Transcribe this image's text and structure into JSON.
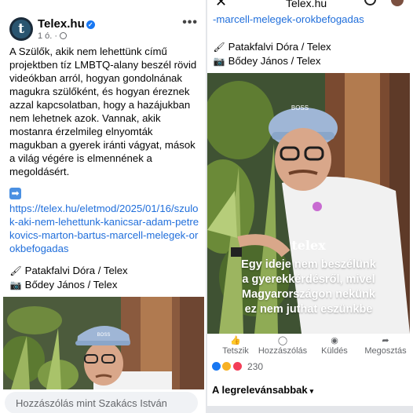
{
  "left": {
    "page_name": "Telex.hu",
    "avatar_letter": "t",
    "time": "1 ó.",
    "more": "•••",
    "paragraphs": [
      "A Szülők, akik nem lehettünk című projektben tíz LMBTQ-alany beszél rövid videókban arról, hogyan gondolnának magukra szülőként, és hogyan éreznek azzal kapcsolatban, hogy a hazájukban nem lehetnek azok. Vannak, akik mostanra érzelmileg elnyomták magukban a gyerek iránti vágyat, mások a világ végére is elmennének a megoldásért."
    ],
    "arrow": "➡",
    "link": "https://telex.hu/eletmod/2025/01/16/szulok-aki-nem-lehettunk-kanicsar-adam-petrekovics-marton-bartus-marcell-melegek-orokbefogadas",
    "credit1_emoji": "🖌",
    "credit1": "Patakfalvi Dóra / Telex",
    "credit2_emoji": "📷",
    "credit2": "Bődey János / Telex",
    "comment_placeholder": "Hozzászólás mint Szakács István"
  },
  "right": {
    "nav_title": "Telex.hu",
    "close": "✕",
    "link_tail": "-marcell-melegek-orokbefogadas",
    "credit1_emoji": "🖌",
    "credit1": "Patakfalvi Dóra / Telex",
    "credit2_emoji": "📷",
    "credit2": "Bődey János / Telex",
    "watermark": "telex",
    "caption_lines": [
      "Egy ideje nem beszélünk",
      "a gyerekkérdésről, mivel",
      "Magyarországon nekünk",
      "ez nem juthat eszünkbe"
    ],
    "cap_text": "BOSS",
    "actions": [
      {
        "icon": "like-icon",
        "label": "Tetszik"
      },
      {
        "icon": "comment-icon",
        "label": "Hozzászólás"
      },
      {
        "icon": "messenger-icon",
        "label": "Küldés"
      },
      {
        "icon": "share-icon",
        "label": "Megosztás"
      }
    ],
    "reaction_count": "230",
    "sort_label": "A legrelevánsabbak"
  },
  "colors": {
    "link": "#216fdb",
    "like": "#1877f2",
    "love": "#f33e58",
    "haha": "#f7b125",
    "cap": "#8aa6c9"
  }
}
